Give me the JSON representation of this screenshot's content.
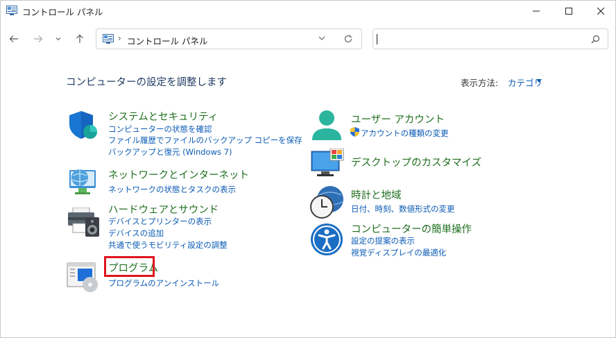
{
  "window": {
    "title": "コントロール パネル"
  },
  "address_bar": {
    "crumb": "コントロール パネル",
    "sep1": "›",
    "sep2": "›"
  },
  "search": {
    "placeholder": ""
  },
  "header": {
    "title": "コンピューターの設定を調整します",
    "view_label": "表示方法:",
    "view_value": "カテゴリ"
  },
  "categories": [
    {
      "title": "システムとセキュリティ",
      "links": [
        "コンピューターの状態を確認",
        "ファイル履歴でファイルのバックアップ コピーを保存",
        "バックアップと復元 (Windows 7)"
      ]
    },
    {
      "title": "ネットワークとインターネット",
      "links": [
        "ネットワークの状態とタスクの表示"
      ]
    },
    {
      "title": "ハードウェアとサウンド",
      "links": [
        "デバイスとプリンターの表示",
        "デバイスの追加",
        "共通で使うモビリティ設定の調整"
      ]
    },
    {
      "title": "プログラム",
      "links": [
        "プログラムのアンインストール"
      ]
    },
    {
      "title": "ユーザー アカウント",
      "links": [
        "アカウントの種類の変更"
      ]
    },
    {
      "title": "デスクトップのカスタマイズ",
      "links": []
    },
    {
      "title": "時計と地域",
      "links": [
        "日付、時刻、数値形式の変更"
      ]
    },
    {
      "title": "コンピューターの簡単操作",
      "links": [
        "設定の提案の表示",
        "視覚ディスプレイの最適化"
      ]
    }
  ],
  "colors": {
    "link": "#0b5bb5",
    "category_title": "#1f6e1f",
    "highlight": "#e0141d"
  }
}
